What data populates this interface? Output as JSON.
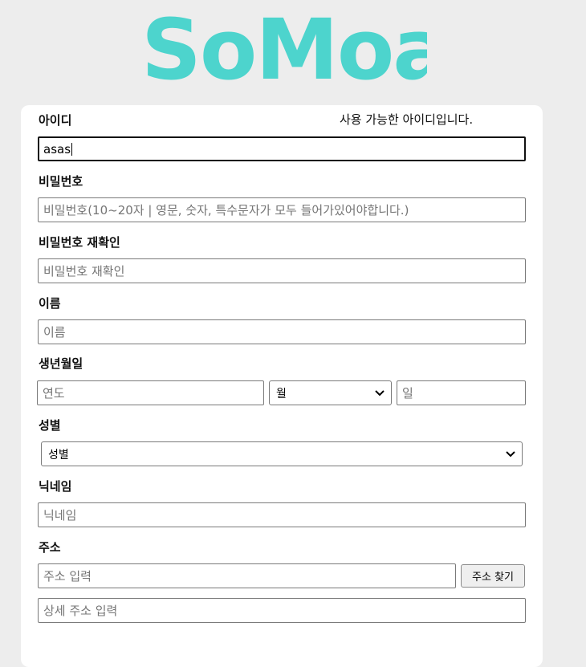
{
  "logo": {
    "text": "SoMoa",
    "color": "#4dd4cd"
  },
  "id": {
    "label": "아이디",
    "value": "asas",
    "status": "사용 가능한 아이디입니다."
  },
  "password": {
    "label": "비밀번호",
    "placeholder": "비밀번호(10~20자 | 영문, 숫자, 특수문자가 모두 들어가있어야합니다.)"
  },
  "password_confirm": {
    "label": "비밀번호 재확인",
    "placeholder": "비밀번호 재확인"
  },
  "name": {
    "label": "이름",
    "placeholder": "이름"
  },
  "birth": {
    "label": "생년월일",
    "year_placeholder": "연도",
    "month_selected": "월",
    "day_placeholder": "일"
  },
  "gender": {
    "label": "성별",
    "selected": "성별"
  },
  "nickname": {
    "label": "닉네임",
    "placeholder": "닉네임"
  },
  "address": {
    "label": "주소",
    "placeholder": "주소 입력",
    "search_button": "주소 찾기",
    "detail_placeholder": "상세 주소 입력"
  }
}
